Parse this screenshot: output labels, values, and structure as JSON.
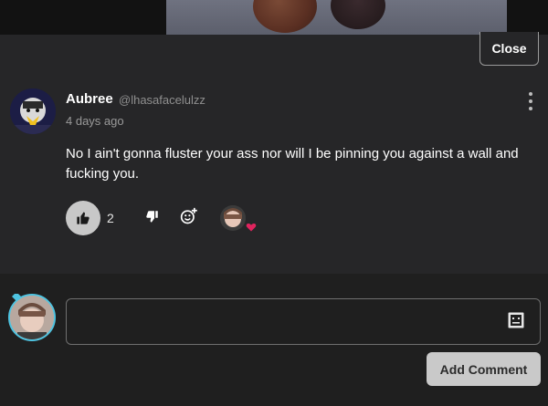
{
  "close_button": {
    "label": "Close"
  },
  "comment": {
    "author": "Aubree",
    "handle": "@lhasafacelulzz",
    "timestamp": "4 days ago",
    "text": "No I ain't gonna fluster your ass nor will I be pinning you against a wall and fucking you.",
    "like_count": "2"
  },
  "composer": {
    "placeholder": "",
    "submit_label": "Add Comment"
  },
  "icons": {
    "menu": "kebab-menu-icon",
    "like": "thumbs-up-icon",
    "dislike": "thumbs-down-icon",
    "emoji": "add-emoji-icon",
    "heart": "heart-icon",
    "emoji_picker": "emoji-picker-icon"
  },
  "colors": {
    "panel_bg": "#262628",
    "composer_bg": "#1f1f1f",
    "heart": "#e0245e",
    "avatar_ring": "#4ec3e0"
  }
}
